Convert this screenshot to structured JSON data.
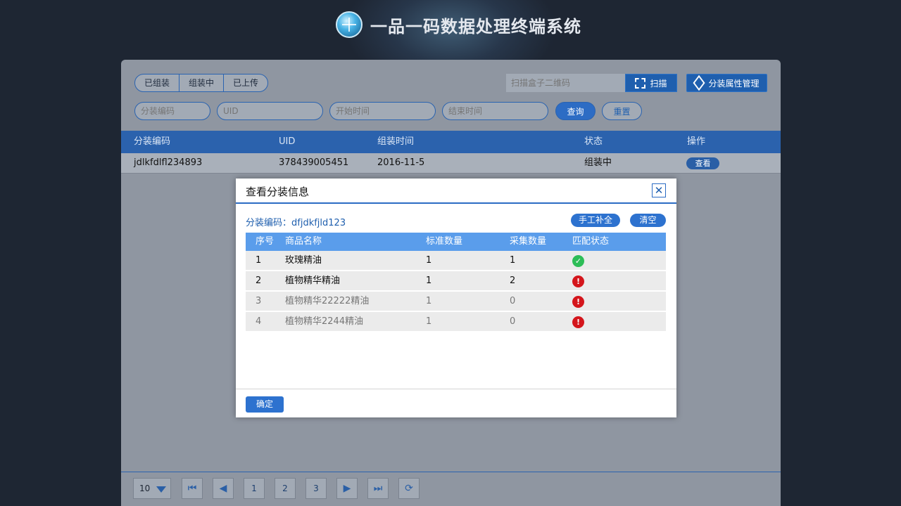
{
  "app": {
    "title": "一品一码数据处理终端系统"
  },
  "tabs": [
    {
      "label": "已组装"
    },
    {
      "label": "组装中"
    },
    {
      "label": "已上传"
    }
  ],
  "scan": {
    "placeholder": "扫描盒子二维码",
    "button": "扫描"
  },
  "attr_manage": {
    "label": "分装属性管理"
  },
  "filters": {
    "code_placeholder": "分装编码",
    "uid_placeholder": "UID",
    "start_placeholder": "开始时间",
    "end_placeholder": "结束时间",
    "query": "查询",
    "reset": "重置"
  },
  "main_table": {
    "columns": [
      "分装编码",
      "UID",
      "组装时间",
      "状态",
      "操作"
    ],
    "rows": [
      {
        "code": "jdlkfdlfl234893",
        "uid": "378439005451",
        "time": "2016-11-5",
        "status": "组装中",
        "action": "查看"
      }
    ]
  },
  "pager": {
    "page_size": "10",
    "pages": [
      "1",
      "2",
      "3"
    ]
  },
  "dialog": {
    "title": "查看分装信息",
    "code_label": "分装编码：dfjdkfjld123",
    "fill_button": "手工补全",
    "clear_button": "清空",
    "columns": [
      "序号",
      "商品名称",
      "标准数量",
      "采集数量",
      "匹配状态"
    ],
    "rows": [
      {
        "no": "1",
        "name": "玫瑰精油",
        "std": "1",
        "got": "1",
        "match": "ok"
      },
      {
        "no": "2",
        "name": "植物精华精油",
        "std": "1",
        "got": "2",
        "match": "error"
      },
      {
        "no": "3",
        "name": "植物精华22222精油",
        "std": "1",
        "got": "0",
        "match": "error"
      },
      {
        "no": "4",
        "name": "植物精华2244精油",
        "std": "1",
        "got": "0",
        "match": "error"
      }
    ],
    "confirm": "确定"
  },
  "colors": {
    "primary": "#2b62ad",
    "ok": "#2dbd57",
    "error": "#d4161c"
  }
}
